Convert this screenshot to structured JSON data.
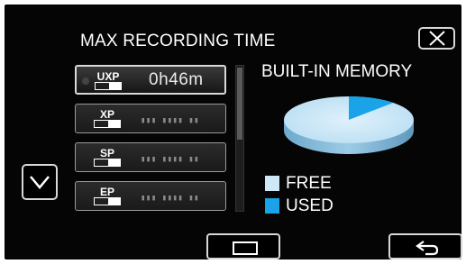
{
  "screen": {
    "title": "MAX RECORDING TIME"
  },
  "close_button": {
    "icon": "close-icon"
  },
  "modes": [
    {
      "code": "UXP",
      "time": "0h46m",
      "selected": true
    },
    {
      "code": "XP",
      "placeholder": "▮▮▮ ▮▮▮▮ ▮▮",
      "selected": false
    },
    {
      "code": "SP",
      "placeholder": "▮▮▮ ▮▮▮▮ ▮▮",
      "selected": false
    },
    {
      "code": "EP",
      "placeholder": "▮▮▮ ▮▮▮▮ ▮▮",
      "selected": false
    }
  ],
  "scroll_down_button": {
    "icon": "chevron-down-icon"
  },
  "memory": {
    "label": "BUILT-IN MEMORY",
    "used_fraction": 0.12,
    "free_color": "#cfe8f7",
    "used_color": "#1aa3e8",
    "legend": {
      "free": "FREE",
      "used": "USED"
    }
  },
  "bottom_bar": {
    "frame_button_icon": "frame-icon",
    "back_button_icon": "back-arrow-icon"
  }
}
